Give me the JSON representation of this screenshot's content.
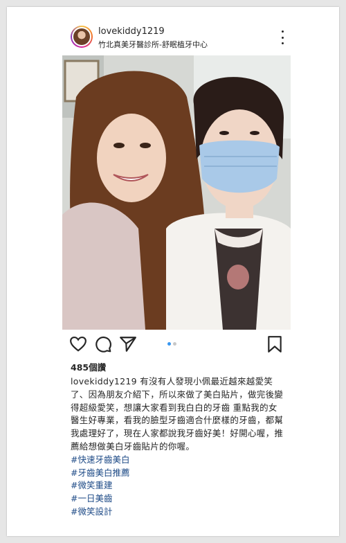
{
  "post": {
    "username": "lovekiddy1219",
    "location": "竹北真美牙醫診所-舒眠植牙中心",
    "likes": "485個讚",
    "caption_user": "lovekiddy1219",
    "caption_text": " 有沒有人發現小佩最近越來越愛笑了、因為朋友介紹下，所以來做了美白貼片，做完後變得超級愛笑，想讓大家看到我白白的牙齒 重點我的女醫生好專業，看我的臉型牙齒適合什麼樣的牙齒，都幫我處理好了，現在人家都說我牙齒好美！好開心喔，推薦給想做美白牙齒貼片的你喔。",
    "hashtags": [
      "#快速牙齒美白",
      "#牙齒美白推薦",
      "#微笑重建",
      "#一日美齒",
      "#微笑設計"
    ],
    "carousel": {
      "count": 2,
      "active": 1
    }
  },
  "icons": {
    "avatar": "avatar",
    "more": "more-dots-icon",
    "like": "heart-icon",
    "comment": "comment-icon",
    "share": "paper-plane-icon",
    "save": "bookmark-icon"
  }
}
